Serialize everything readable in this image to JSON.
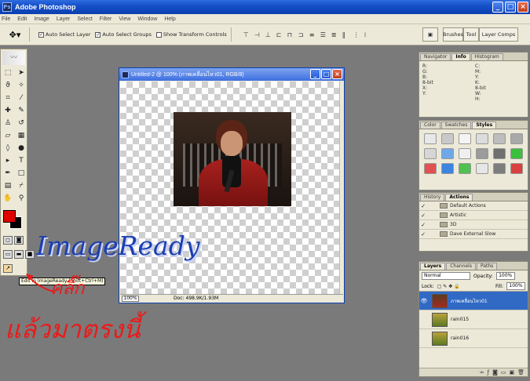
{
  "app": {
    "title": "Adobe Photoshop"
  },
  "menu": [
    "File",
    "Edit",
    "Image",
    "Layer",
    "Select",
    "Filter",
    "View",
    "Window",
    "Help"
  ],
  "options": {
    "auto_select_layer": "Auto Select Layer",
    "auto_select_groups": "Auto Select Groups",
    "show_transform": "Show Transform Controls",
    "brushes_tab": "Brushes",
    "tool_presets_tab": "Tool",
    "layer_comps_tab": "Layer Comps"
  },
  "document": {
    "title": "Untitled-2 @ 100% (ภาพเคลื่อนไหว01, RGB/8)",
    "zoom": "100%",
    "doc_info": "Doc: 498.9K/1.93M"
  },
  "tooltip": "Edit in ImageReady (Shift+Ctrl+M)",
  "overlay": {
    "imageready": "ImageReady",
    "click": "คลิ๊ก",
    "then_here": "แล้วมาตรงนี้"
  },
  "panels": {
    "nav": {
      "tabs": [
        "Navigator",
        "Info",
        "Histogram"
      ],
      "active": 1,
      "info_left": [
        "R:",
        "G:",
        "B:",
        "8-bit",
        "X:",
        "Y:"
      ],
      "info_right": [
        "C:",
        "M:",
        "Y:",
        "K:",
        "8-bit",
        "W:",
        "H:"
      ]
    },
    "styles": {
      "tabs": [
        "Color",
        "Swatches",
        "Styles"
      ],
      "active": 2
    },
    "actions": {
      "tabs": [
        "History",
        "Actions"
      ],
      "active": 1,
      "rows": [
        "Default Actions",
        "Artistic",
        "3D",
        "Dave External Slow"
      ]
    },
    "layers": {
      "tabs": [
        "Layers",
        "Channels",
        "Paths"
      ],
      "active": 0,
      "blend_mode": "Normal",
      "opacity_label": "Opacity:",
      "opacity": "100%",
      "lock_label": "Lock:",
      "fill_label": "Fill:",
      "fill": "100%",
      "rows": [
        {
          "name": "ภาพเคลื่อนไหว01",
          "selected": true
        },
        {
          "name": "rain015",
          "selected": false
        },
        {
          "name": "rain016",
          "selected": false
        }
      ]
    }
  },
  "colors": {
    "foreground": "#e00000",
    "background": "#000000",
    "title_blue": "#1550c8",
    "overlay_red": "#ea1b1b",
    "overlay_blue": "#1c3fb0"
  }
}
